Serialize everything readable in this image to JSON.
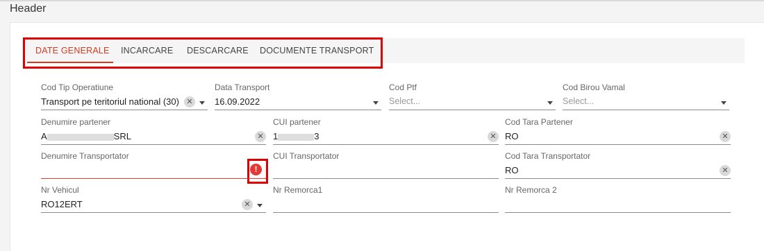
{
  "header": {
    "title": "Header"
  },
  "tabs": [
    {
      "label": "DATE GENERALE",
      "active": true
    },
    {
      "label": "INCARCARE",
      "active": false
    },
    {
      "label": "DESCARCARE",
      "active": false
    },
    {
      "label": "DOCUMENTE TRANSPORT",
      "active": false
    }
  ],
  "fields": {
    "cod_tip_operatiune": {
      "label": "Cod Tip Operatiune",
      "value": "Transport pe teritoriul national (30)"
    },
    "data_transport": {
      "label": "Data Transport",
      "value": "16.09.2022"
    },
    "cod_ptf": {
      "label": "Cod Ptf",
      "placeholder": "Select..."
    },
    "cod_birou_vamal": {
      "label": "Cod Birou Vamal",
      "placeholder": "Select..."
    },
    "denumire_partener": {
      "label": "Denumire partener",
      "value_start": "A",
      "value_end": "SRL"
    },
    "cui_partener": {
      "label": "CUI partener",
      "value_start": "1",
      "value_end": "3"
    },
    "cod_tara_partener": {
      "label": "Cod Tara Partener",
      "value": "RO"
    },
    "denumire_transportator": {
      "label": "Denumire Transportator",
      "value": ""
    },
    "cui_transportator": {
      "label": "CUI Transportator",
      "value": ""
    },
    "cod_tara_transportator": {
      "label": "Cod Tara Transportator",
      "value": "RO"
    },
    "nr_vehicul": {
      "label": "Nr Vehicul",
      "value": "RO12ERT"
    },
    "nr_remorca1": {
      "label": "Nr Remorca1",
      "value": ""
    },
    "nr_remorca2": {
      "label": "Nr Remorca 2",
      "value": ""
    }
  },
  "icons": {
    "clear": "close-circle-icon",
    "dropdown": "chevron-down-icon",
    "error": "error-exclamation-icon"
  },
  "colors": {
    "accent": "#d93a1d",
    "error": "#e53935",
    "highlight": "#e00000"
  }
}
